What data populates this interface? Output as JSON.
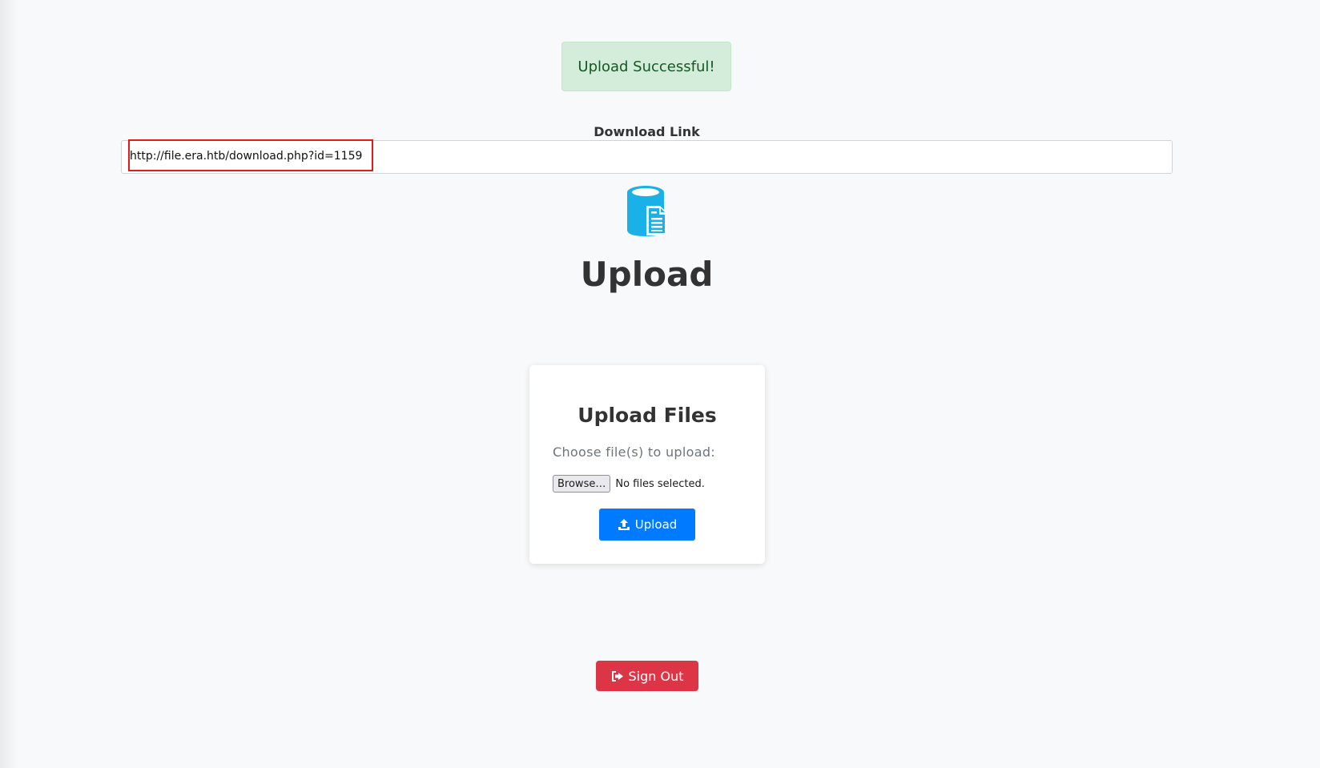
{
  "alert": {
    "message": "Upload Successful!"
  },
  "download": {
    "label": "Download Link",
    "url": "http://file.era.htb/download.php?id=1159"
  },
  "header": {
    "icon": "database-file-icon",
    "title": "Upload"
  },
  "card": {
    "title": "Upload Files",
    "choose_label": "Choose file(s) to upload:",
    "browse_label": "Browse…",
    "no_files_text": "No files selected.",
    "upload_label": "Upload"
  },
  "footer": {
    "signout_label": "Sign Out"
  },
  "colors": {
    "success_bg": "#d4edda",
    "success_text": "#155724",
    "primary": "#007bff",
    "danger": "#dc3545",
    "icon_blue": "#1ab0e8",
    "highlight": "#e31b1b"
  }
}
